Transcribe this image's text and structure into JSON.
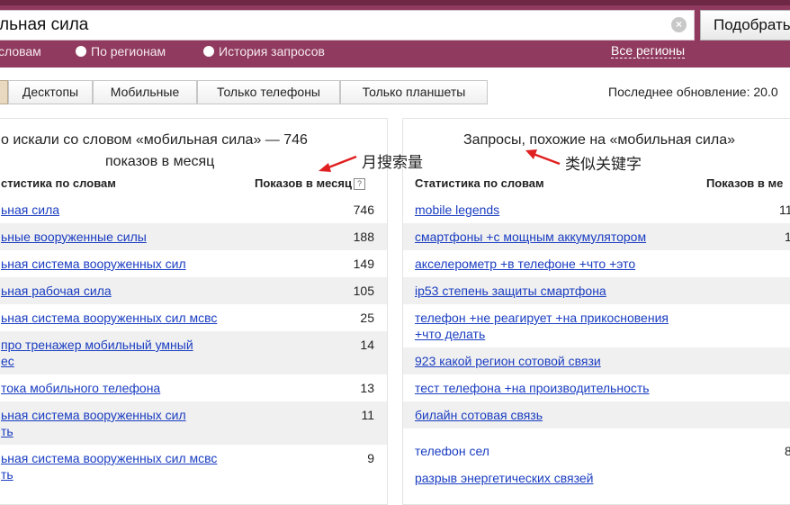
{
  "search": {
    "value": "льная сила",
    "button_label": "Подобрать"
  },
  "modes": [
    {
      "label": "словам"
    },
    {
      "label": "По регионам"
    },
    {
      "label": "История запросов"
    }
  ],
  "all_regions_label": "Все регионы",
  "device_tabs": [
    "",
    "Десктопы",
    "Мобильные",
    "Только телефоны",
    "Только планшеты"
  ],
  "last_update": "Последнее обновление: 20.0",
  "left_panel": {
    "title_line1": "о искали со словом «мобильная сила» — 746",
    "title_line2": "показов в месяц",
    "col_keywords": "стистика по словам",
    "col_count": "Показов в месяц",
    "rows": [
      {
        "kw1": "ьная сила",
        "kw2": "",
        "count": "746"
      },
      {
        "kw1": "ьные вооруженные силы",
        "kw2": "",
        "count": "188"
      },
      {
        "kw1": "ьная система вооруженных сил",
        "kw2": "",
        "count": "149"
      },
      {
        "kw1": "ьная рабочая сила",
        "kw2": "",
        "count": "105"
      },
      {
        "kw1": "ьная система вооруженных сил мсвс",
        "kw2": "",
        "count": "25"
      },
      {
        "kw1": "про тренажер мобильный умный",
        "kw2": "ес",
        "count": "14"
      },
      {
        "kw1": "тока мобильного телефона",
        "kw2": "",
        "count": "13"
      },
      {
        "kw1": "ьная система вооруженных сил",
        "kw2": "ть",
        "count": "11"
      },
      {
        "kw1": "ьная система вооруженных сил мсвс",
        "kw2": "ть",
        "count": "9"
      }
    ]
  },
  "right_panel": {
    "title": "Запросы, похожие на «мобильная сила»",
    "col_keywords": "Статистика по словам",
    "col_count": "Показов в ме",
    "rows": [
      {
        "kw1": "mobile legends",
        "kw2": "",
        "count": "11"
      },
      {
        "kw1": "смартфоны +с мощным аккумулятором",
        "kw2": "",
        "count": "1"
      },
      {
        "kw1": "акселерометр +в телефоне +что +это",
        "kw2": "",
        "count": ""
      },
      {
        "kw1": "ip53 степень защиты смартфона",
        "kw2": "",
        "count": ""
      },
      {
        "kw1": "телефон +не реагирует +на прикосновения",
        "kw2": "+что делать",
        "count": ""
      },
      {
        "kw1": "923 какой регион сотовой связи",
        "kw2": "",
        "count": ""
      },
      {
        "kw1": "тест телефона +на производительность",
        "kw2": "",
        "count": ""
      },
      {
        "kw1": "билайн сотовая связь",
        "kw2": "",
        "count": ""
      },
      {
        "kw1": "телефон сел",
        "kw2": "",
        "count": "8"
      },
      {
        "kw1": "разрыв энергетических связей",
        "kw2": "",
        "count": ""
      }
    ]
  },
  "annotations": {
    "left_note": "月搜索量",
    "right_note": "类似关键字",
    "arrow_color": "#e02020"
  },
  "colors": {
    "band": "#8f3a5e",
    "link": "#1a3dc1",
    "row_shade": "#f0f0f0"
  }
}
